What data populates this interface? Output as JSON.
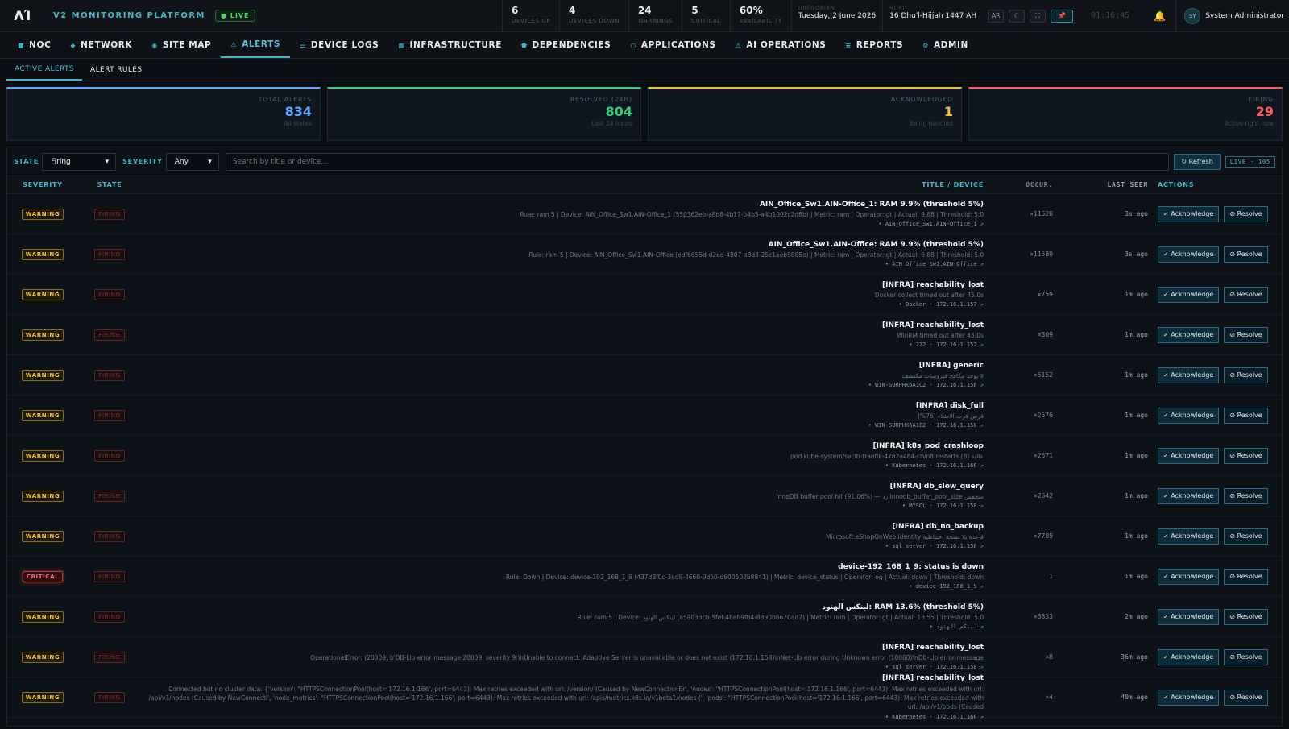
{
  "app": {
    "logo": "ΛΊ",
    "brand": "V2 MONITORING PLATFORM",
    "live": "● LIVE"
  },
  "stats": [
    {
      "num": "6",
      "label": "DEVICES UP"
    },
    {
      "num": "4",
      "label": "DEVICES DOWN"
    },
    {
      "num": "24",
      "label": "WARNINGS"
    },
    {
      "num": "5",
      "label": "CRITICAL"
    },
    {
      "num": "60%",
      "label": "AVAILABILITY"
    }
  ],
  "calendar": {
    "gregorian_label": "GREGORIAN",
    "gregorian": "Tuesday, 2 June 2026",
    "hijri_label": "HIJRI",
    "hijri": "16 Dhu'l-Hijjah 1447 AH"
  },
  "toolbar": {
    "lang": "AR",
    "theme": "☾",
    "fullscreen": "⛶",
    "pin": "📌",
    "clock": "01:16:45",
    "bell": "🔔"
  },
  "user": {
    "initials": "SY",
    "name": "System Administrator"
  },
  "nav": [
    {
      "icon": "■",
      "label": "NOC"
    },
    {
      "icon": "◆",
      "label": "NETWORK"
    },
    {
      "icon": "◉",
      "label": "SITE MAP"
    },
    {
      "icon": "⚠",
      "label": "ALERTS"
    },
    {
      "icon": "☰",
      "label": "DEVICE LOGS"
    },
    {
      "icon": "▦",
      "label": "INFRASTRUCTURE"
    },
    {
      "icon": "⬟",
      "label": "DEPENDENCIES"
    },
    {
      "icon": "○",
      "label": "APPLICATIONS"
    },
    {
      "icon": "⚠",
      "label": "AI OPERATIONS"
    },
    {
      "icon": "≡",
      "label": "REPORTS"
    },
    {
      "icon": "⚙",
      "label": "ADMIN"
    }
  ],
  "subnav": [
    "ACTIVE ALERTS",
    "ALERT RULES"
  ],
  "cards": [
    {
      "label": "TOTAL ALERTS",
      "value": "834",
      "sub": "All states",
      "color": "#5aa8ff"
    },
    {
      "label": "RESOLVED (24H)",
      "value": "804",
      "sub": "Last 24 hours",
      "color": "#2fd07a"
    },
    {
      "label": "ACKNOWLEDGED",
      "value": "1",
      "sub": "Being handled",
      "color": "#f0c230"
    },
    {
      "label": "FIRING",
      "value": "29",
      "sub": "Active right now",
      "color": "#ff5a5a"
    }
  ],
  "filters": {
    "state_label": "STATE",
    "state_value": "Firing",
    "severity_label": "SEVERITY",
    "severity_value": "Any",
    "search_placeholder": "Search by title or device...",
    "refresh": "↻ Refresh",
    "live": "LIVE · 105"
  },
  "columns": {
    "severity": "SEVERITY",
    "state": "STATE",
    "title": "TITLE / DEVICE",
    "occ": "OCCUR.",
    "last": "LAST SEEN",
    "actions": "ACTIONS"
  },
  "actions": {
    "ack": "✓ Acknowledge",
    "res": "⊘ Resolve"
  },
  "rows": [
    {
      "sev": "WARNING",
      "state": "FIRING",
      "title": "AIN_Office_Sw1.AIN-Office_1: RAM 9.9% (threshold 5%)",
      "detail": "Rule: ram 5 | Device: AIN_Office_Sw1.AIN-Office_1 (550362eb-a8b8-4b17-b4b5-a4b1002c2d8b) | Metric: ram | Operator: gt | Actual: 9.88 | Threshold: 5.0",
      "device": "• AIN_Office_Sw1.AIN-Office_1",
      "occ": "×11520",
      "last": "3s ago"
    },
    {
      "sev": "WARNING",
      "state": "FIRING",
      "title": "AIN_Office_Sw1.AIN-Office: RAM 9.9% (threshold 5%)",
      "detail": "Rule: ram 5 | Device: AIN_Office_Sw1.AIN-Office (edf6655d-d2ed-4807-a8d3-25c1aeb9885e) | Metric: ram | Operator: gt | Actual: 9.88 | Threshold: 5.0",
      "device": "• AIN_Office_Sw1.AIN-Office",
      "occ": "×11580",
      "last": "3s ago"
    },
    {
      "sev": "WARNING",
      "state": "FIRING",
      "title": "[INFRA] reachability_lost",
      "detail": "Docker collect timed out after 45.0s",
      "device": "• Docker · 172.16.1.157",
      "occ": "×759",
      "last": "1m ago"
    },
    {
      "sev": "WARNING",
      "state": "FIRING",
      "title": "[INFRA] reachability_lost",
      "detail": "WinRM timed out after 45.0s",
      "device": "• 222 · 172.16.1.157",
      "occ": "×309",
      "last": "1m ago"
    },
    {
      "sev": "WARNING",
      "state": "FIRING",
      "title": "[INFRA] generic",
      "detail": "لا يوجد مكافح فيروسات مكتشف",
      "device": "• WIN-SURPHK6A1C2 · 172.16.1.158",
      "occ": "×5152",
      "last": "1m ago"
    },
    {
      "sev": "WARNING",
      "state": "FIRING",
      "title": "[INFRA] disk_full",
      "detail": "قرص قرب الامتلاء (76%)",
      "device": "• WIN-SURPHK6A1C2 · 172.16.1.158",
      "occ": "×2576",
      "last": "1m ago"
    },
    {
      "sev": "WARNING",
      "state": "FIRING",
      "title": "[INFRA] k8s_pod_crashloop",
      "detail": "pod kube-system/svclb-traefik-4782a484-rzvn8 restarts (8) عالية",
      "device": "• Kubernetes · 172.16.1.166",
      "occ": "×2571",
      "last": "1m ago"
    },
    {
      "sev": "WARNING",
      "state": "FIRING",
      "title": "[INFRA] db_slow_query",
      "detail": "InnoDB buffer pool hit (91.06%) — زد innodb_buffer_pool_size منخفض",
      "device": "• MYSQL · 172.16.1.158",
      "occ": "×2642",
      "last": "1m ago"
    },
    {
      "sev": "WARNING",
      "state": "FIRING",
      "title": "[INFRA] db_no_backup",
      "detail": "Microsoft.eShopOnWeb.Identity قاعدة بلا نسخة احتياطية",
      "device": "• sql server · 172.16.1.158",
      "occ": "×7789",
      "last": "1m ago"
    },
    {
      "sev": "CRITICAL",
      "state": "FIRING",
      "title": "device-192_168_1_9: status is down",
      "detail": "Rule: Down | Device: device-192_168_1_9 (437d3f0c-3ad9-4660-9d50-d600502b8841) | Metric: device_status | Operator: eq | Actual: down | Threshold: down",
      "device": "• device-192_168_1_9",
      "occ": "1",
      "last": "1m ago"
    },
    {
      "sev": "WARNING",
      "state": "FIRING",
      "title": "لينكس الهنود: RAM 13.6% (threshold 5%)",
      "detail": "Rule: ram 5 | Device: لينكس الهنود (a5a033cb-5fef-48af-9fb4-8390b6620ad7) | Metric: ram | Operator: gt | Actual: 13.55 | Threshold: 5.0",
      "device": "• لينكس الهنود",
      "occ": "×5833",
      "last": "2m ago"
    },
    {
      "sev": "WARNING",
      "state": "FIRING",
      "title": "[INFRA] reachability_lost",
      "detail": "OperationalError: (20009, b'DB-Lib error message 20009, severity 9:\\nUnable to connect: Adaptive Server is unavailable or does not exist (172.16.1.158)\\nNet-Lib error during Unknown error (10060)\\nDB-Lib error message",
      "device": "• sql server · 172.16.1.158",
      "occ": "×8",
      "last": "36m ago"
    },
    {
      "sev": "WARNING",
      "state": "FIRING",
      "title": "[INFRA] reachability_lost",
      "detail": "Connected but no cluster data: {'version': \"HTTPSConnectionPool(host='172.16.1.166', port=6443): Max retries exceeded with url: /version/ (Caused by NewConnectionEr', 'nodes': \"HTTPSConnectionPool(host='172.16.1.166', port=6443): Max retries exceeded with url: /api/v1/nodes (Caused by NewConnecti', 'node_metrics': \"HTTPSConnectionPool(host='172.16.1.166', port=6443): Max retries exceeded with url: /apis/metrics.k8s.io/v1beta1/nodes (', 'pods': \"HTTPSConnectionPool(host='172.16.1.166', port=6443): Max retries exceeded with url: /api/v1/pods (Caused",
      "device": "• Kubernetes · 172.16.1.166",
      "occ": "×4",
      "last": "40m ago"
    }
  ]
}
